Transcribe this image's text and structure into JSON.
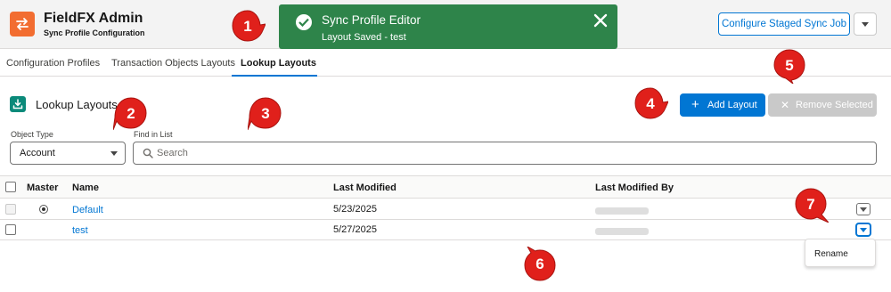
{
  "header": {
    "app_title": "FieldFX Admin",
    "app_subtitle": "Sync Profile Configuration",
    "configure_button": "Configure Staged Sync Job",
    "app_icon": "arrows-swap-icon"
  },
  "toast": {
    "title": "Sync Profile Editor",
    "message": "Layout Saved - test",
    "color": "#2e844a",
    "icon": "success-check-icon"
  },
  "tabs": [
    {
      "label": "Configuration Profiles",
      "active": false
    },
    {
      "label": "Transaction Objects Layouts",
      "active": false
    },
    {
      "label": "Lookup Layouts",
      "active": true
    }
  ],
  "section": {
    "title": "Lookup Layouts",
    "icon": "download-icon",
    "add_button": "Add Layout",
    "remove_button": "Remove Selected"
  },
  "filters": {
    "object_type_label": "Object Type",
    "object_type_value": "Account",
    "find_label": "Find in List",
    "search_placeholder": "Search"
  },
  "table": {
    "columns": [
      "Master",
      "Name",
      "Last Modified",
      "Last Modified By"
    ],
    "rows": [
      {
        "name": "Default",
        "last_modified": "5/23/2025",
        "master": true
      },
      {
        "name": "test",
        "last_modified": "5/27/2025",
        "master": false
      }
    ]
  },
  "row_menu": {
    "items": [
      "Rename"
    ]
  },
  "callouts": [
    "1",
    "2",
    "3",
    "4",
    "5",
    "6",
    "7"
  ],
  "colors": {
    "brand": "#0176d3",
    "app_icon": "#f26d31",
    "callout": "#e0201b"
  }
}
